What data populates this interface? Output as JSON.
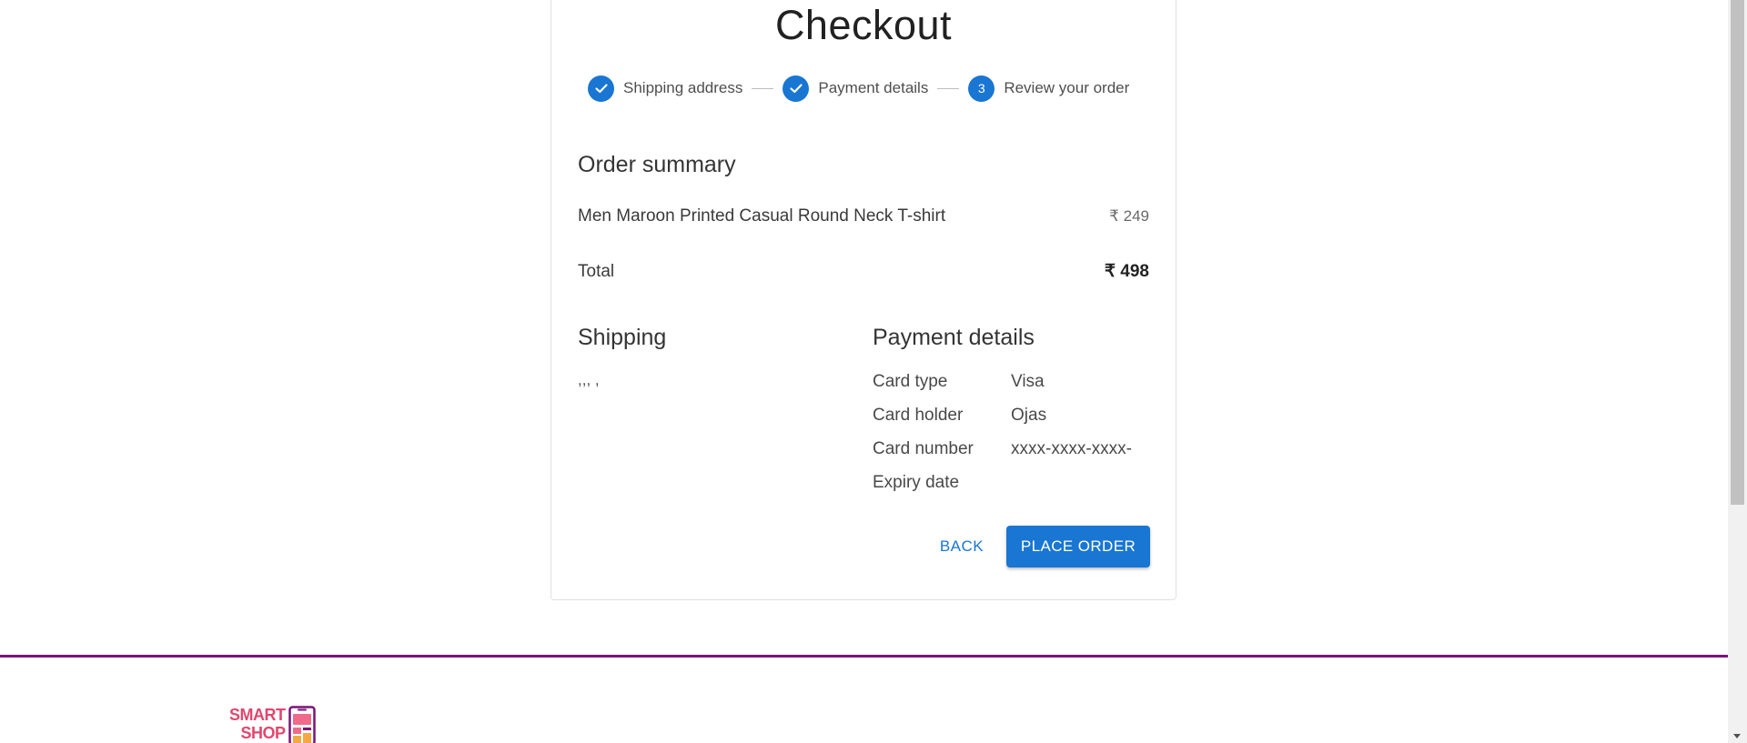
{
  "page_title": "Checkout",
  "stepper": {
    "steps": [
      {
        "label": "Shipping address",
        "state": "completed",
        "icon": "check-icon"
      },
      {
        "label": "Payment details",
        "state": "completed",
        "icon": "check-icon"
      },
      {
        "label": "Review your order",
        "state": "active",
        "number": "3"
      }
    ]
  },
  "order_summary": {
    "heading": "Order summary",
    "items": [
      {
        "name": "Men Maroon Printed Casual Round Neck T-shirt",
        "price": "₹ 249"
      }
    ],
    "total_label": "Total",
    "total_value": "₹ 498"
  },
  "shipping": {
    "heading": "Shipping",
    "address": ",,, ,"
  },
  "payment": {
    "heading": "Payment details",
    "rows": [
      {
        "key": "Card type",
        "value": "Visa"
      },
      {
        "key": "Card holder",
        "value": "Ojas"
      },
      {
        "key": "Card number",
        "value": "xxxx-xxxx-xxxx-"
      },
      {
        "key": "Expiry date",
        "value": ""
      }
    ]
  },
  "actions": {
    "back_label": "BACK",
    "place_order_label": "PLACE ORDER"
  },
  "footer": {
    "logo_line1": "SMART",
    "logo_line2": "SHOP"
  },
  "colors": {
    "primary": "#1976d2",
    "footer_line": "#7b1377",
    "logo_pink": "#e2466e",
    "logo_purple": "#7b1377"
  }
}
